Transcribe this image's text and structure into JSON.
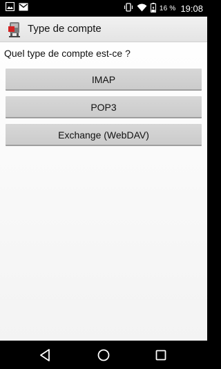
{
  "status_bar": {
    "icons": [
      "image-icon",
      "mail-icon",
      "vibrate-icon",
      "wifi-icon",
      "battery-icon"
    ],
    "battery_percent": "16 %",
    "time": "19:08"
  },
  "action_bar": {
    "title": "Type de compte",
    "icon": "app-icon"
  },
  "main": {
    "question": "Quel type de compte est-ce ?",
    "buttons": [
      {
        "label": "IMAP"
      },
      {
        "label": "POP3"
      },
      {
        "label": "Exchange (WebDAV)"
      }
    ]
  },
  "nav_bar": {
    "icons": [
      "back-icon",
      "home-icon",
      "recents-icon"
    ]
  },
  "colors": {
    "status_bar": "#000000",
    "action_bar": "#e8e8e8",
    "button": "#d0d0d0",
    "background": "#f7f7f7",
    "text": "#111111"
  }
}
